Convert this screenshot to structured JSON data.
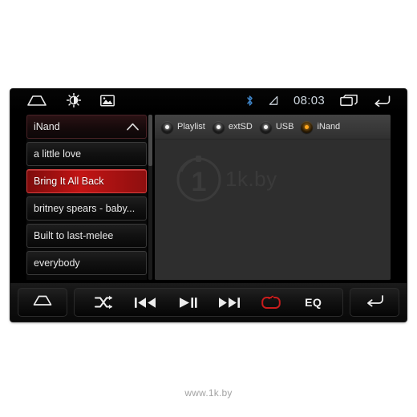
{
  "statusbar": {
    "left_icons": [
      {
        "name": "home-icon",
        "label": "Home"
      },
      {
        "name": "brightness-icon",
        "label": "Brightness"
      },
      {
        "name": "wallpaper-icon",
        "label": "Wallpaper"
      }
    ],
    "bluetooth_icon": "bluetooth-icon",
    "signal_icon": "signal-icon",
    "clock": "08:03",
    "right_icons": [
      {
        "name": "recent-apps-icon",
        "label": "Recent apps"
      },
      {
        "name": "back-icon",
        "label": "Back"
      }
    ]
  },
  "playlist": {
    "header": {
      "label": "iNand",
      "chevron": "chevron-up-icon"
    },
    "items": [
      {
        "label": "a little love",
        "selected": false
      },
      {
        "label": "Bring It All Back",
        "selected": true
      },
      {
        "label": "britney spears - baby...",
        "selected": false
      },
      {
        "label": "Built to last-melee",
        "selected": false
      },
      {
        "label": "everybody",
        "selected": false
      }
    ]
  },
  "sources": {
    "tabs": [
      {
        "label": "Playlist",
        "selected": false
      },
      {
        "label": "extSD",
        "selected": false
      },
      {
        "label": "USB",
        "selected": false
      },
      {
        "label": "iNand",
        "selected": true
      }
    ],
    "accent_color": "#ffa61e"
  },
  "content": {
    "watermark_text": "1k.by"
  },
  "controls": {
    "home_label": "Home",
    "shuffle_label": "Shuffle",
    "previous_label": "Previous",
    "play_pause_label": "Play / Pause",
    "next_label": "Next",
    "repeat_label": "Repeat",
    "repeat_active_color": "#c81c1c",
    "eq_label": "EQ",
    "back_label": "Back"
  },
  "page": {
    "site_watermark": "www.1k.by"
  }
}
